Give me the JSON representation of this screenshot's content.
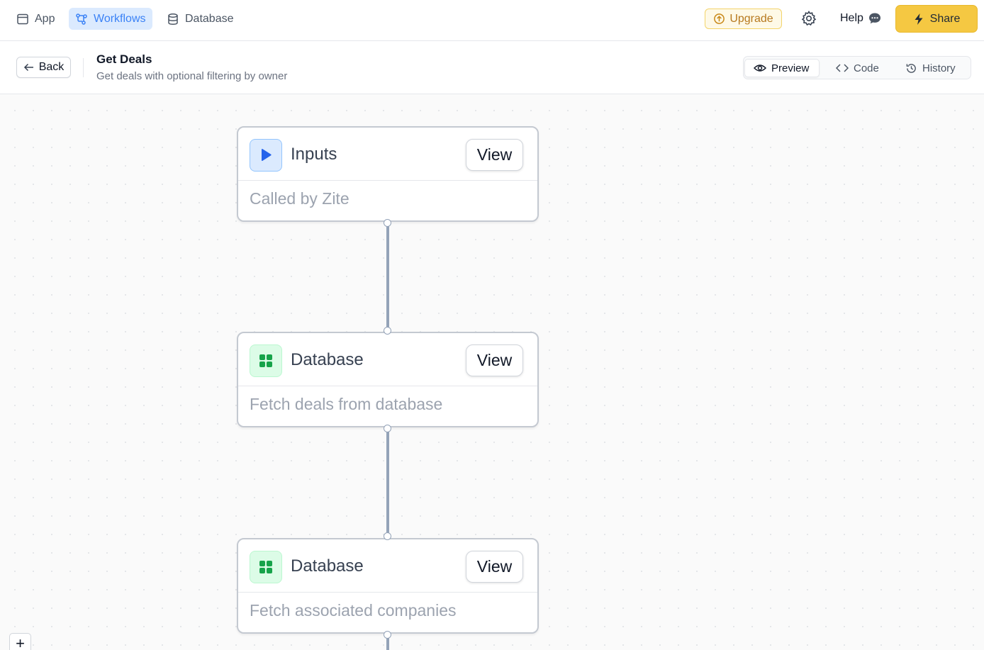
{
  "nav": {
    "app": "App",
    "workflows": "Workflows",
    "database": "Database"
  },
  "actions": {
    "upgrade": "Upgrade",
    "help": "Help",
    "share": "Share"
  },
  "header": {
    "back": "Back",
    "title": "Get Deals",
    "subtitle": "Get deals with optional filtering by owner"
  },
  "view_tabs": {
    "preview": "Preview",
    "code": "Code",
    "history": "History",
    "selected": "Preview"
  },
  "nodes": [
    {
      "title": "Inputs",
      "description": "Called by Zite",
      "button": "View",
      "icon": "play-icon",
      "accent": "#2563eb"
    },
    {
      "title": "Database",
      "description": "Fetch deals from database",
      "button": "View",
      "icon": "table-grid-icon",
      "accent": "#16a34a"
    },
    {
      "title": "Database",
      "description": "Fetch associated companies",
      "button": "View",
      "icon": "table-grid-icon",
      "accent": "#16a34a"
    }
  ],
  "zoom": {
    "in": "+"
  },
  "colors": {
    "accent_blue": "#3b82f6",
    "share_yellow": "#f5c842",
    "connector": "#94a3b8"
  }
}
